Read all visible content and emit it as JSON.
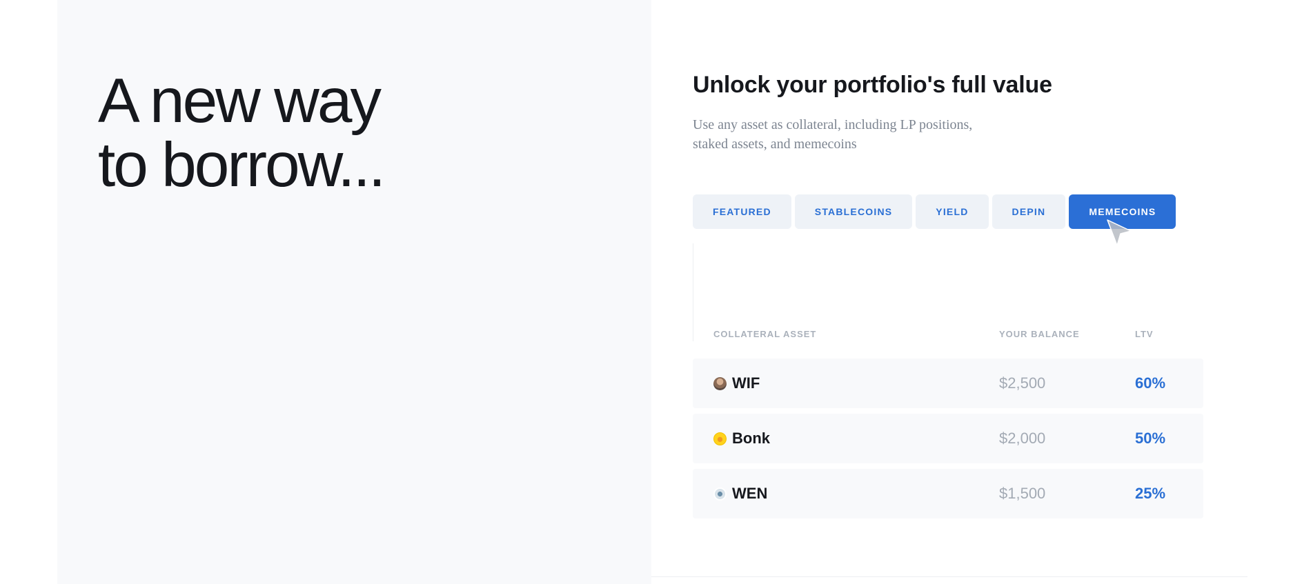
{
  "hero": {
    "line1": "A new way",
    "line2": "to borrow..."
  },
  "section": {
    "heading": "Unlock your portfolio's full value",
    "subheading": "Use any asset as collateral, including LP positions, staked assets, and memecoins"
  },
  "tabs": [
    {
      "label": "FEATURED",
      "active": false
    },
    {
      "label": "STABLECOINS",
      "active": false
    },
    {
      "label": "YIELD",
      "active": false
    },
    {
      "label": "DEPIN",
      "active": false
    },
    {
      "label": "MEMECOINS",
      "active": true
    }
  ],
  "table": {
    "headers": {
      "asset": "COLLATERAL ASSET",
      "balance": "YOUR BALANCE",
      "ltv": "LTV"
    },
    "rows": [
      {
        "asset": "WIF",
        "icon": "wif-coin-icon",
        "balance": "$2,500",
        "ltv": "60%"
      },
      {
        "asset": "Bonk",
        "icon": "bonk-coin-icon",
        "balance": "$2,000",
        "ltv": "50%"
      },
      {
        "asset": "WEN",
        "icon": "wen-coin-icon",
        "balance": "$1,500",
        "ltv": "25%"
      }
    ]
  },
  "colors": {
    "accent": "#2b6fd6",
    "tab_background": "#eef2f7",
    "panel_background": "#f8f9fb",
    "muted_text": "#7d8591"
  },
  "cursor_icon": "mouse-pointer-icon"
}
